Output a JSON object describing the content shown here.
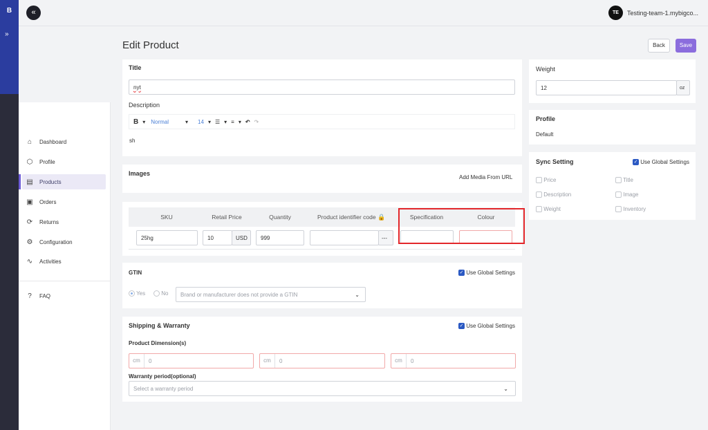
{
  "app": {
    "logo": "B",
    "collapse_symbol": "«",
    "expand_symbol": "»"
  },
  "user": {
    "initials": "TE",
    "store": "Testing-team-1.mybigco..."
  },
  "sidebar": {
    "items": [
      {
        "label": "Dashboard",
        "icon": "home-icon",
        "glyph": "⌂"
      },
      {
        "label": "Profile",
        "icon": "cube-icon",
        "glyph": "⬡"
      },
      {
        "label": "Products",
        "icon": "document-icon",
        "glyph": "▤"
      },
      {
        "label": "Orders",
        "icon": "box-icon",
        "glyph": "▣"
      },
      {
        "label": "Returns",
        "icon": "refresh-icon",
        "glyph": "⟳"
      },
      {
        "label": "Configuration",
        "icon": "gear-icon",
        "glyph": "⚙"
      },
      {
        "label": "Activities",
        "icon": "activity-icon",
        "glyph": "∿"
      }
    ],
    "faq": {
      "label": "FAQ",
      "icon": "help-icon",
      "glyph": "?"
    },
    "active": "Products"
  },
  "page": {
    "title": "Edit Product",
    "back": "Back",
    "save": "Save"
  },
  "details": {
    "title_label": "Title",
    "title_value": "nyt",
    "description_label": "Description",
    "toolbar": {
      "bold": "B",
      "style": "Normal",
      "size": "14",
      "caret": "▾",
      "list": "☰",
      "align": "≡",
      "undo": "↶",
      "redo": "↷"
    },
    "description_value": "sh"
  },
  "images": {
    "label": "Images",
    "add_media": "Add Media From URL"
  },
  "variant_table": {
    "headers": [
      "SKU",
      "Retail Price",
      "Quantity",
      "Product identifier code",
      "Specification",
      "Colour"
    ],
    "sku": "25hg",
    "price": "10",
    "currency": "USD",
    "quantity": "999",
    "identifier_more": "---",
    "specification": "",
    "colour": ""
  },
  "gtin": {
    "label": "GTIN",
    "use_global": "Use Global Settings",
    "yes": "Yes",
    "no": "No",
    "select": "Brand or manufacturer does not provide a GTIN"
  },
  "shipping": {
    "label": "Shipping & Warranty",
    "use_global": "Use Global Settings",
    "dimension_label": "Product Dimension(s)",
    "unit": "cm",
    "dims": [
      "0",
      "0",
      "0"
    ],
    "warranty_label": "Warranty period(optional)",
    "warranty_placeholder": "Select a warranty period"
  },
  "weight": {
    "label": "Weight",
    "value": "12",
    "unit": "oz"
  },
  "profile": {
    "label": "Profile",
    "value": "Default"
  },
  "sync": {
    "label": "Sync Setting",
    "use_global": "Use Global Settings",
    "options": [
      "Price",
      "Title",
      "Description",
      "Image",
      "Weight",
      "Inventory"
    ]
  },
  "colors": {
    "accent": "#8b6ddd",
    "rail": "#2b3d9f",
    "highlight": "#e3262a"
  }
}
